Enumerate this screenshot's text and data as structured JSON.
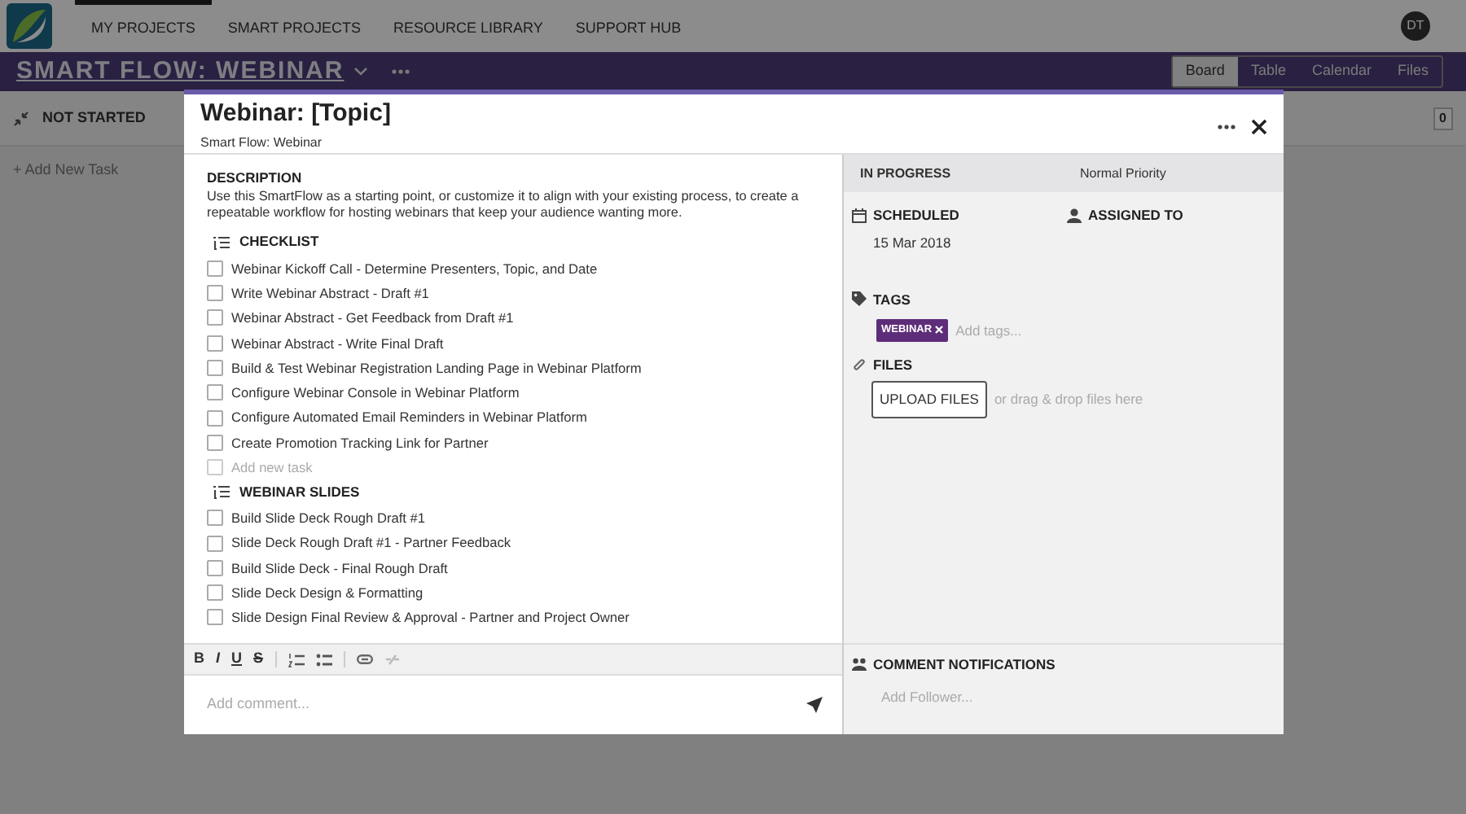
{
  "app": {
    "nav": [
      {
        "label": "MY PROJECTS",
        "selected": true
      },
      {
        "label": "SMART PROJECTS",
        "selected": false
      },
      {
        "label": "RESOURCE LIBRARY",
        "selected": false
      },
      {
        "label": "SUPPORT HUB",
        "selected": false
      }
    ],
    "avatar": "DT",
    "project_title": "SMART FLOW: WEBINAR",
    "views": [
      {
        "label": "Board",
        "selected": true
      },
      {
        "label": "Table",
        "selected": false
      },
      {
        "label": "Calendar",
        "selected": false
      },
      {
        "label": "Files",
        "selected": false
      }
    ],
    "column": {
      "title": "NOT STARTED",
      "count": "0",
      "add": "+ Add New Task"
    }
  },
  "modal": {
    "title": "Webinar: [Topic]",
    "subtitle": "Smart Flow: Webinar",
    "description": {
      "heading": "DESCRIPTION",
      "text": "Use this SmartFlow as a starting point, or customize it to align with your existing process, to create a repeatable workflow for hosting webinars that keep your audience wanting more."
    },
    "checklists": [
      {
        "title": "CHECKLIST",
        "add_placeholder": "Add new task",
        "items": [
          {
            "label": "Webinar Kickoff Call - Determine Presenters, Topic, and Date",
            "checked": false
          },
          {
            "label": "Write Webinar Abstract - Draft #1",
            "checked": false
          },
          {
            "label": "Webinar Abstract - Get Feedback from Draft #1",
            "checked": false
          },
          {
            "label": "Webinar Abstract - Write Final Draft",
            "checked": false
          },
          {
            "label": "Build & Test Webinar Registration Landing Page in Webinar Platform",
            "checked": false
          },
          {
            "label": "Configure Webinar Console in Webinar Platform",
            "checked": false
          },
          {
            "label": "Configure Automated Email Reminders in Webinar Platform",
            "checked": false
          },
          {
            "label": "Create Promotion Tracking Link for Partner",
            "checked": false
          }
        ]
      },
      {
        "title": "WEBINAR SLIDES",
        "items": [
          {
            "label": "Build Slide Deck Rough Draft #1",
            "checked": false
          },
          {
            "label": "Slide Deck Rough Draft #1 - Partner Feedback",
            "checked": false
          },
          {
            "label": "Build Slide Deck - Final Rough Draft",
            "checked": false
          },
          {
            "label": "Slide Deck Design & Formatting",
            "checked": false
          },
          {
            "label": "Slide Design Final Review & Approval - Partner and Project Owner",
            "checked": false
          }
        ]
      }
    ],
    "toolbar": [
      "B",
      "I",
      "U",
      "S"
    ],
    "comment_placeholder": "Add comment...",
    "status": "IN PROGRESS",
    "priority": "Normal Priority",
    "scheduled": {
      "label": "SCHEDULED",
      "value": "15 Mar 2018"
    },
    "assigned": {
      "label": "ASSIGNED TO"
    },
    "tags": {
      "label": "TAGS",
      "items": [
        "WEBINAR"
      ],
      "placeholder": "Add tags..."
    },
    "files": {
      "label": "FILES",
      "button": "UPLOAD FILES",
      "hint": "or drag & drop files here"
    },
    "notifications": {
      "label": "COMMENT NOTIFICATIONS",
      "placeholder": "Add Follower..."
    }
  }
}
